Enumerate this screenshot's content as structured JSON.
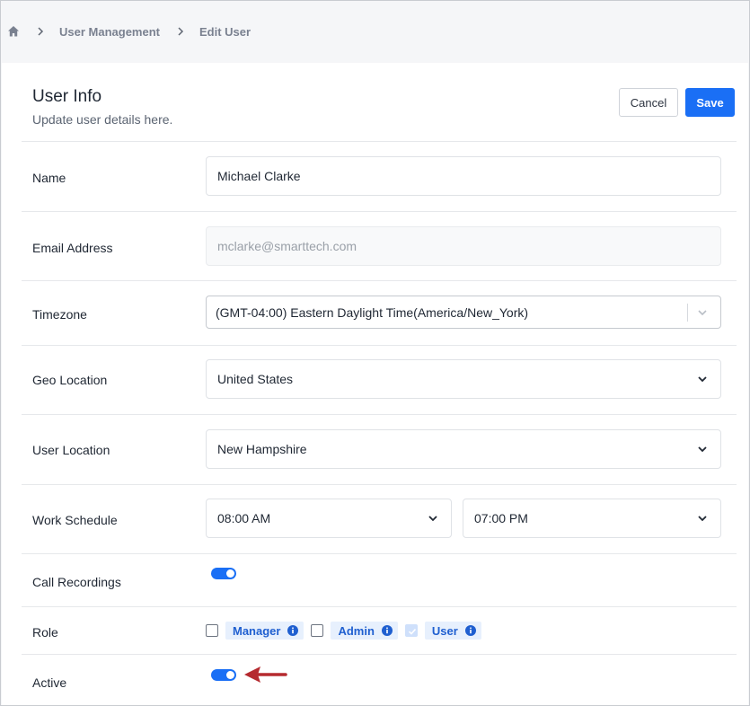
{
  "breadcrumb": {
    "home_icon": "home-icon",
    "items": [
      "User Management",
      "Edit User"
    ]
  },
  "header": {
    "title": "User Info",
    "subtitle": "Update user details here.",
    "cancel_label": "Cancel",
    "save_label": "Save"
  },
  "form": {
    "name": {
      "label": "Name",
      "value": "Michael Clarke"
    },
    "email": {
      "label": "Email Address",
      "value": "mclarke@smarttech.com"
    },
    "timezone": {
      "label": "Timezone",
      "value": "(GMT-04:00) Eastern Daylight Time(America/New_York)"
    },
    "geo_location": {
      "label": "Geo Location",
      "value": "United States"
    },
    "user_location": {
      "label": "User Location",
      "value": "New Hampshire"
    },
    "work_schedule": {
      "label": "Work Schedule",
      "start": "08:00 AM",
      "end": "07:00 PM"
    },
    "call_recordings": {
      "label": "Call Recordings",
      "enabled": true
    },
    "role": {
      "label": "Role",
      "options": [
        {
          "label": "Manager",
          "checked": false
        },
        {
          "label": "Admin",
          "checked": false
        },
        {
          "label": "User",
          "checked": true
        }
      ]
    },
    "active": {
      "label": "Active",
      "enabled": true
    }
  },
  "colors": {
    "accent": "#1a6ff5",
    "pill_bg": "#e7f0fd",
    "annotation_arrow": "#b52a2f"
  }
}
